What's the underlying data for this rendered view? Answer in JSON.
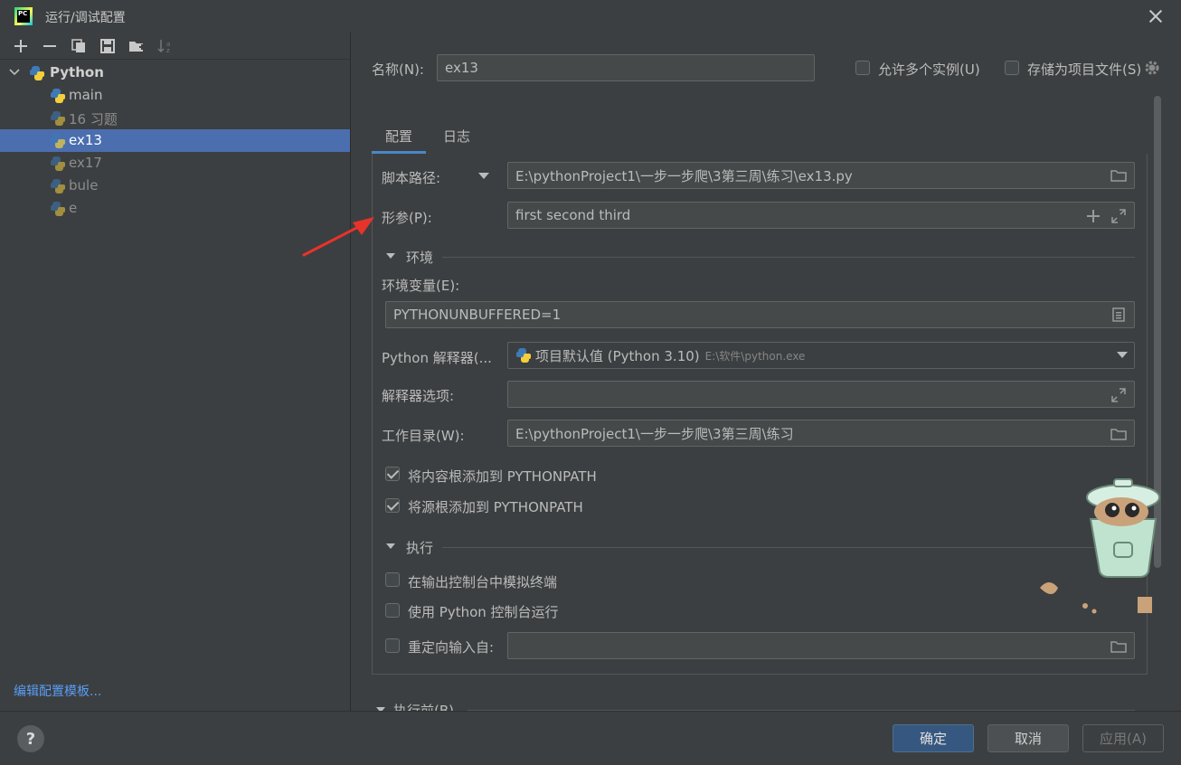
{
  "window": {
    "title": "运行/调试配置"
  },
  "tree": {
    "root": "Python",
    "items": [
      "main",
      "16 习题",
      "ex13",
      "ex17",
      "bule",
      "e"
    ],
    "selected": "ex13",
    "edit_templates": "编辑配置模板..."
  },
  "header": {
    "name_label": "名称(N):",
    "name_value": "ex13",
    "allow_multiple": "允许多个实例(U)",
    "store_as_file": "存储为项目文件(S)"
  },
  "tabs": [
    "配置",
    "日志"
  ],
  "config": {
    "script_path_label": "脚本路径:",
    "script_path_value": "E:\\pythonProject1\\一步一步爬\\3第三周\\练习\\ex13.py",
    "params_label": "形参(P):",
    "params_value": "first second third",
    "env_section": "环境",
    "env_vars_label": "环境变量(E):",
    "env_vars_value": "PYTHONUNBUFFERED=1",
    "interpreter_label": "Python 解释器(...",
    "interpreter_value": "项目默认值 (Python 3.10)",
    "interpreter_path": "E:\\软件\\python.exe",
    "interp_options_label": "解释器选项:",
    "workdir_label": "工作目录(W):",
    "workdir_value": "E:\\pythonProject1\\一步一步爬\\3第三周\\练习",
    "add_content_roots": "将内容根添加到 PYTHONPATH",
    "add_source_roots": "将源根添加到 PYTHONPATH",
    "exec_section": "执行",
    "emulate_terminal": "在输出控制台中模拟终端",
    "run_console": "使用 Python 控制台运行",
    "redirect_input": "重定向输入自:",
    "before_launch": "执行前(B)"
  },
  "buttons": {
    "ok": "确定",
    "cancel": "取消",
    "apply": "应用(A)",
    "help": "?"
  },
  "colors": {
    "accent": "#4a88c7",
    "selected_row": "#4b6eaf",
    "arrow": "#e8332a",
    "link": "#589df6"
  }
}
